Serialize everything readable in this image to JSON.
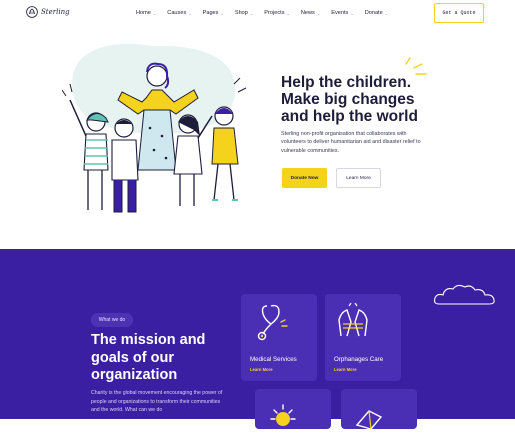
{
  "header": {
    "logo_text": "Sterling",
    "nav": [
      {
        "label": "Home",
        "has_dropdown": true
      },
      {
        "label": "Causes",
        "has_dropdown": true
      },
      {
        "label": "Pages",
        "has_dropdown": true
      },
      {
        "label": "Shop",
        "has_dropdown": true
      },
      {
        "label": "Projects",
        "has_dropdown": true
      },
      {
        "label": "News",
        "has_dropdown": true
      },
      {
        "label": "Events",
        "has_dropdown": true
      },
      {
        "label": "Donate",
        "has_dropdown": true
      }
    ],
    "quote_button": "Get a Quote"
  },
  "hero": {
    "title_lines": [
      "Help the children.",
      "Make big changes",
      "and help the world"
    ],
    "description": "Sterling non-profit organisation that collaborates with volunteers to deliver humanitarian aid and disaster relief to vulnerable communities.",
    "donate_button": "Donate Now",
    "learn_button": "Learn More",
    "illustration": "children-group-illustration"
  },
  "mission": {
    "badge": "What we do",
    "title_lines": [
      "The mission and",
      "goals of our",
      "organization"
    ],
    "description": "Charity is the global movement encouraging the power of people and organizations to transform their communities and the world. What can we do",
    "cards": [
      {
        "title": "Medical Services",
        "link": "Learn More",
        "icon": "stethoscope-icon"
      },
      {
        "title": "Orphanages Care",
        "link": "Learn More",
        "icon": "caring-hands-icon"
      },
      {
        "title": "",
        "link": "",
        "icon": "sun-icon"
      },
      {
        "title": "",
        "link": "",
        "icon": "book-icon"
      }
    ]
  },
  "colors": {
    "accent": "#f5d21b",
    "purple": "#3a1fa3",
    "card": "#4a2fb5",
    "text": "#1d1d3a"
  }
}
